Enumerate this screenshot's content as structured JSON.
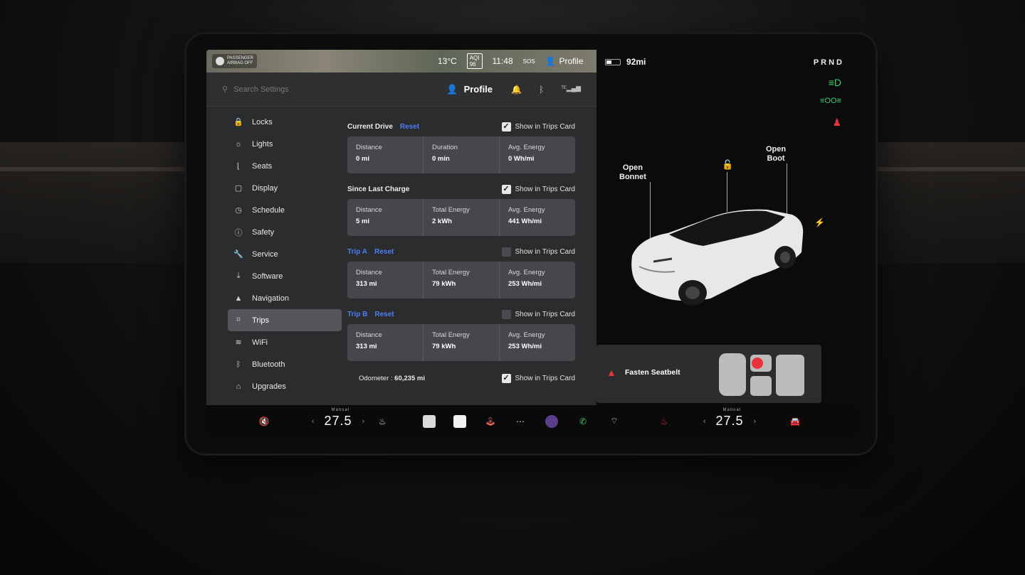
{
  "status_bar": {
    "airbag_line1": "PASSENGER",
    "airbag_line2": "AIRBAG OFF",
    "temperature": "13°C",
    "aqi_label": "AQI 96",
    "time": "11:48",
    "sos": "SOS",
    "profile": "Profile"
  },
  "header": {
    "search_placeholder": "Search Settings",
    "profile_label": "Profile"
  },
  "menu": [
    {
      "label": "Locks",
      "icon": "lock-icon",
      "glyph": "🔒"
    },
    {
      "label": "Lights",
      "icon": "sun-icon",
      "glyph": "☼"
    },
    {
      "label": "Seats",
      "icon": "seat-icon",
      "glyph": "⌊"
    },
    {
      "label": "Display",
      "icon": "display-icon",
      "glyph": "▢"
    },
    {
      "label": "Schedule",
      "icon": "clock-icon",
      "glyph": "◷"
    },
    {
      "label": "Safety",
      "icon": "info-icon",
      "glyph": "ⓘ"
    },
    {
      "label": "Service",
      "icon": "wrench-icon",
      "glyph": "🔧"
    },
    {
      "label": "Software",
      "icon": "download-icon",
      "glyph": "⤓"
    },
    {
      "label": "Navigation",
      "icon": "navigation-icon",
      "glyph": "▲"
    },
    {
      "label": "Trips",
      "icon": "trips-icon",
      "glyph": "⌗",
      "active": true
    },
    {
      "label": "WiFi",
      "icon": "wifi-icon",
      "glyph": "≋"
    },
    {
      "label": "Bluetooth",
      "icon": "bluetooth-icon",
      "glyph": "ᛒ"
    },
    {
      "label": "Upgrades",
      "icon": "bag-icon",
      "glyph": "⌂"
    }
  ],
  "trips": {
    "current_drive": {
      "title": "Current Drive",
      "reset": "Reset",
      "show_label": "Show in Trips Card",
      "checked": true,
      "cells": [
        {
          "label": "Distance",
          "value": "0 mi"
        },
        {
          "label": "Duration",
          "value": "0 min"
        },
        {
          "label": "Avg. Energy",
          "value": "0 Wh/mi"
        }
      ]
    },
    "since_last_charge": {
      "title": "Since Last Charge",
      "show_label": "Show in Trips Card",
      "checked": true,
      "cells": [
        {
          "label": "Distance",
          "value": "5 mi"
        },
        {
          "label": "Total Energy",
          "value": "2 kWh"
        },
        {
          "label": "Avg. Energy",
          "value": "441 Wh/mi"
        }
      ]
    },
    "trip_a": {
      "title": "Trip A",
      "reset": "Reset",
      "show_label": "Show in Trips Card",
      "checked": false,
      "cells": [
        {
          "label": "Distance",
          "value": "313 mi"
        },
        {
          "label": "Total Energy",
          "value": "79 kWh"
        },
        {
          "label": "Avg. Energy",
          "value": "253 Wh/mi"
        }
      ]
    },
    "trip_b": {
      "title": "Trip B",
      "reset": "Reset",
      "show_label": "Show in Trips Card",
      "checked": false,
      "cells": [
        {
          "label": "Distance",
          "value": "313 mi"
        },
        {
          "label": "Total Energy",
          "value": "79 kWh"
        },
        {
          "label": "Avg. Energy",
          "value": "253 Wh/mi"
        }
      ]
    },
    "odometer": {
      "label": "Odometer :",
      "value": "60,235 mi",
      "show_label": "Show in Trips Card",
      "checked": true
    }
  },
  "vehicle": {
    "range": "92mi",
    "battery_level": 0.35,
    "gear": "PRND",
    "open_bonnet": [
      "Open",
      "Bonnet"
    ],
    "open_boot": [
      "Open",
      "Boot"
    ],
    "alert": "Fasten Seatbelt",
    "colors": {
      "alert_red": "#e8323c",
      "accent_blue": "#4f7df5",
      "indicator_green": "#3ccf6e"
    }
  },
  "bottom_bar": {
    "mute_icon": "volume-mute-icon",
    "driver_temp_mode": "Manual",
    "driver_temp": "27.5",
    "passenger_temp_mode": "Manual",
    "passenger_temp": "27.5"
  }
}
